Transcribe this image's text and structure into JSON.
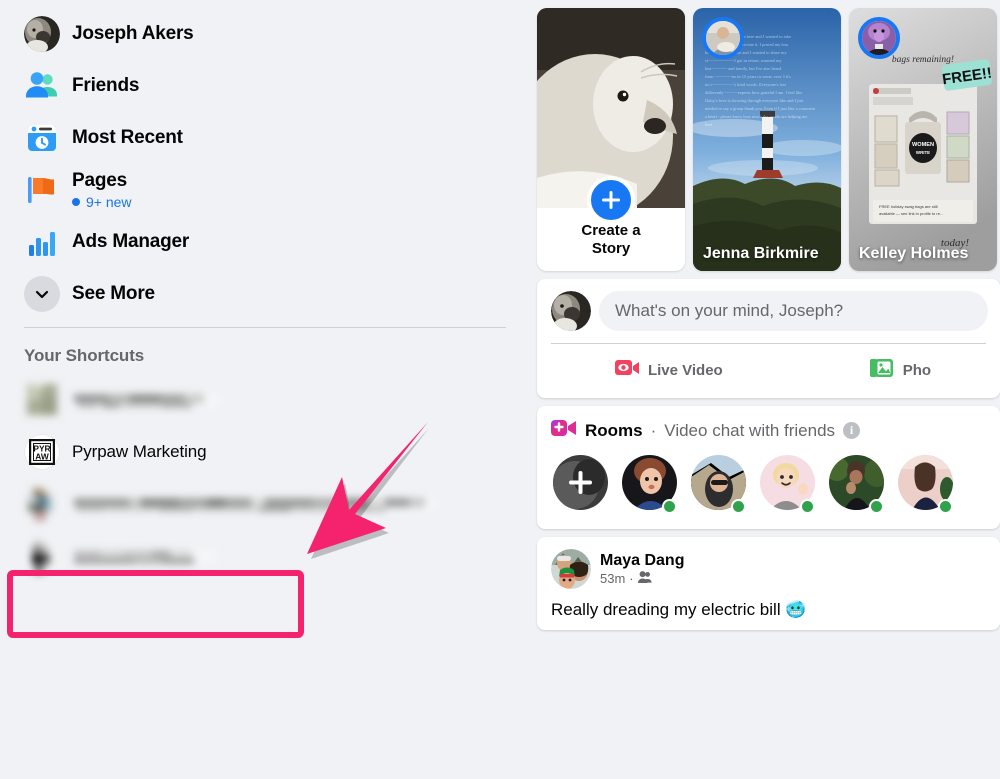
{
  "colors": {
    "page_bg": "#f0f2f5",
    "card_bg": "#ffffff",
    "accent_blue": "#1877f2",
    "link_blue": "#1b74e4",
    "annotation_pink": "#f5226e",
    "text_primary": "#050505",
    "text_secondary": "#65676b",
    "online_green": "#31a24c"
  },
  "sidebar": {
    "items": [
      {
        "label": "Joseph Akers",
        "icon": "profile-avatar-icon",
        "badge": null
      },
      {
        "label": "Friends",
        "icon": "friends-icon",
        "badge": null
      },
      {
        "label": "Most Recent",
        "icon": "most-recent-clock-icon",
        "badge": null
      },
      {
        "label": "Pages",
        "icon": "pages-flag-icon",
        "badge": "9+ new"
      },
      {
        "label": "Ads Manager",
        "icon": "ads-manager-bars-icon",
        "badge": null
      },
      {
        "label": "See More",
        "icon": "chevron-down-icon",
        "badge": null
      }
    ],
    "shortcuts_header": "Your Shortcuts",
    "shortcuts": [
      {
        "label": "",
        "redacted": true,
        "thumb": "blurred-thumb",
        "text_width": 148
      },
      {
        "label": "Pyrpaw Marketing",
        "redacted": false,
        "thumb": "pyrpaw-logo-icon",
        "highlighted": true
      },
      {
        "label": "",
        "redacted": true,
        "thumb": "blurred-thumb",
        "text_width": 365
      },
      {
        "label": "",
        "redacted": true,
        "thumb": "blurred-thumb",
        "text_width": 145
      }
    ]
  },
  "annotation": {
    "arrow": "pink-arrow-pointing-to-pyrpaw-marketing",
    "highlight": "pink-rectangle-around-pyrpaw-marketing"
  },
  "stories": {
    "create": {
      "title_line1": "Create a",
      "title_line2": "Story",
      "icon": "plus-icon"
    },
    "cards": [
      {
        "name": "Jenna Birkmire"
      },
      {
        "name": "Kelley Holmes"
      }
    ]
  },
  "composer": {
    "placeholder": "What's on your mind, Joseph?",
    "actions": [
      {
        "label": "Live Video",
        "icon": "live-video-icon"
      },
      {
        "label": "Pho",
        "icon": "photo-icon"
      }
    ]
  },
  "rooms": {
    "title": "Rooms",
    "separator": "·",
    "subtitle": "Video chat with friends",
    "info_icon": "info-icon",
    "create_icon": "plus-icon",
    "avatars_online": [
      false,
      true,
      true,
      true,
      true,
      true
    ]
  },
  "post": {
    "author": "Maya Dang",
    "time": "53m",
    "meta_separator": "·",
    "audience_icon": "friends-audience-icon",
    "text": "Really dreading my electric bill 🥶"
  }
}
